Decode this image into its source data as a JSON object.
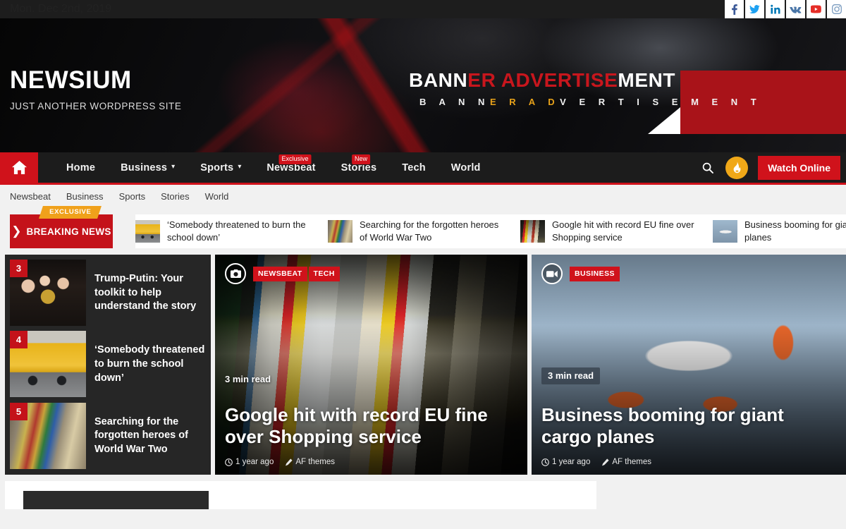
{
  "topbar": {
    "date": "Mon. Dec 2nd, 2019",
    "social": [
      {
        "name": "facebook-icon",
        "label": "Facebook"
      },
      {
        "name": "twitter-icon",
        "label": "Twitter"
      },
      {
        "name": "linkedin-icon",
        "label": "LinkedIn"
      },
      {
        "name": "vk-icon",
        "label": "VK"
      },
      {
        "name": "youtube-icon",
        "label": "YouTube"
      },
      {
        "name": "instagram-icon",
        "label": "Instagram"
      }
    ]
  },
  "brand": {
    "title": "NEWSIUM",
    "tagline": "JUST ANOTHER WORDPRESS SITE"
  },
  "banner_ad": {
    "main_part1": "BANN",
    "main_part2": "ER ADVERTISE",
    "main_part3": "MENT",
    "sub_part1": "B A N N",
    "sub_part2": "E R   A D",
    "sub_part3": "V E R T I S E M E N T"
  },
  "mainnav": {
    "home_icon": "home-icon",
    "items": [
      {
        "label": "Home",
        "caret": false,
        "badge": ""
      },
      {
        "label": "Business",
        "caret": true,
        "badge": ""
      },
      {
        "label": "Sports",
        "caret": true,
        "badge": ""
      },
      {
        "label": "Newsbeat",
        "caret": false,
        "badge": "Exclusive"
      },
      {
        "label": "Stories",
        "caret": false,
        "badge": "New"
      },
      {
        "label": "Tech",
        "caret": false,
        "badge": ""
      },
      {
        "label": "World",
        "caret": false,
        "badge": ""
      }
    ],
    "search_icon": "search-icon",
    "trending_icon": "flame-icon",
    "watch_online": "Watch Online"
  },
  "subnav": {
    "items": [
      "Newsbeat",
      "Business",
      "Sports",
      "Stories",
      "World"
    ]
  },
  "ticker": {
    "exclusive": "EXCLUSIVE",
    "label": "BREAKING NEWS",
    "arrow": "❯",
    "items": [
      {
        "title": "‘Somebody threatened to burn the school down’",
        "thumb": "img-bus"
      },
      {
        "title": "Searching for the forgotten heroes of World War Two",
        "thumb": "img-medal"
      },
      {
        "title": "Google hit with record EU fine over Shopping service",
        "thumb": "img-seoul-sm"
      },
      {
        "title": "Business booming for giant cargo planes",
        "thumb": "img-plane-sm"
      }
    ]
  },
  "features": {
    "mini_posts": [
      {
        "rank": "3",
        "title": "Trump-Putin: Your toolkit to help understand the story",
        "thumb": "img-trump"
      },
      {
        "rank": "4",
        "title": "‘Somebody threatened to burn the school down’",
        "thumb": "img-bus"
      },
      {
        "rank": "5",
        "title": "Searching for the forgotten heroes of World War Two",
        "thumb": "img-medal"
      }
    ],
    "card_mid": {
      "media_icon": "camera-icon",
      "categories": [
        "NEWSBEAT",
        "TECH"
      ],
      "read_time": "3 min read",
      "title": "Google hit with record EU fine over Shopping service",
      "time_ago": "1 year ago",
      "author": "AF themes",
      "photo": "img-seoul"
    },
    "card_right": {
      "media_icon": "video-icon",
      "categories": [
        "BUSINESS"
      ],
      "read_time": "3 min read",
      "title": "Business booming for giant cargo planes",
      "time_ago": "1 year ago",
      "author": "AF themes",
      "photo": "img-plane"
    }
  },
  "colors": {
    "accent_red": "#d0121b",
    "breaking_red": "#c4121a",
    "exclusive_orange": "#f0a11b",
    "trending_amber": "#f0a818",
    "dark_bg": "#1c1c1c",
    "page_bg": "#f1f1f1"
  }
}
